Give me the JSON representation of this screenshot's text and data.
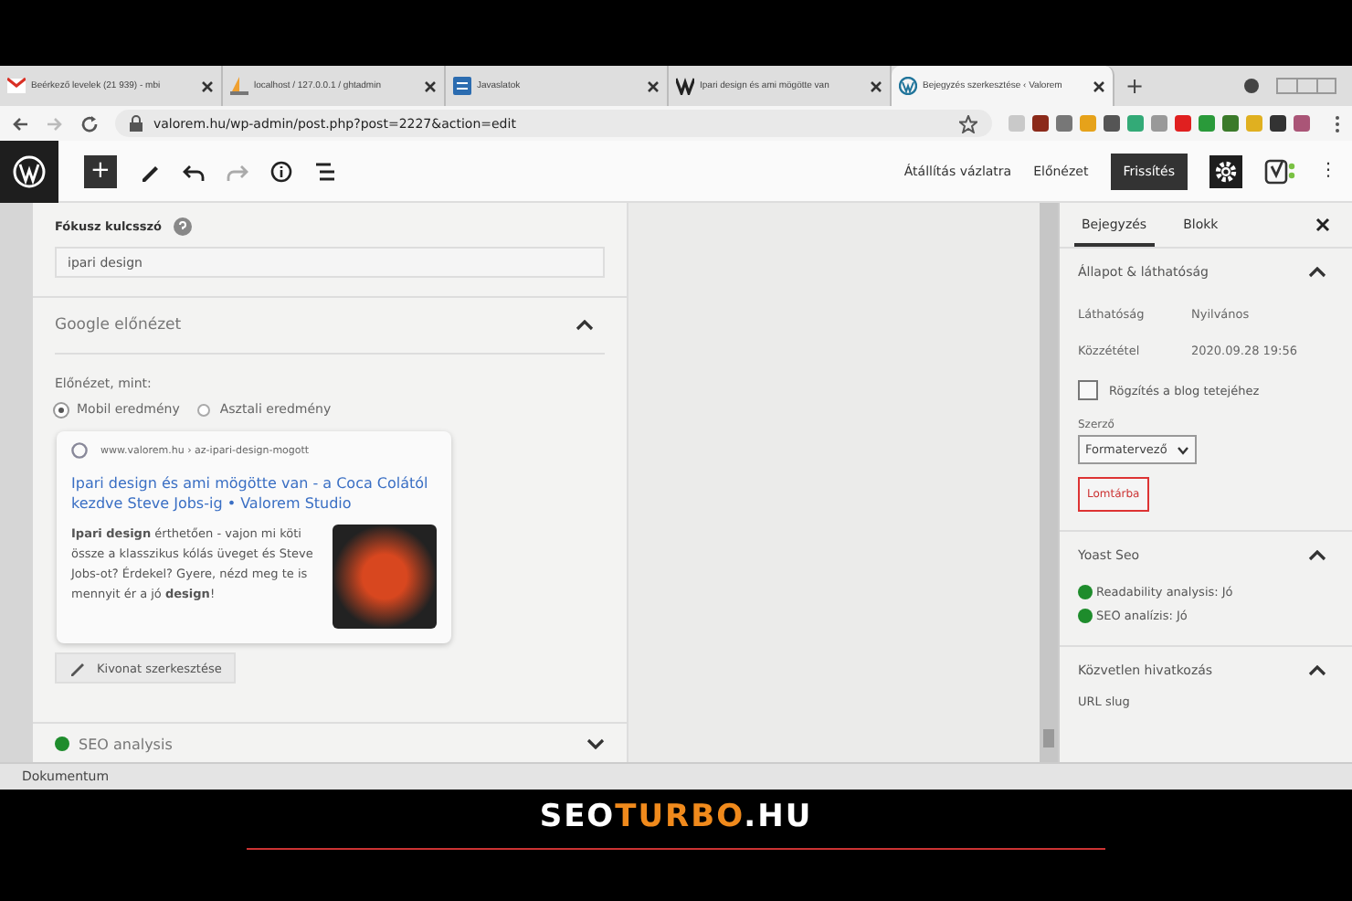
{
  "browser": {
    "tabs": [
      {
        "title": "Beérkező levelek (21 939) - mbi",
        "selected": false
      },
      {
        "title": "localhost / 127.0.0.1 / ghtadmin",
        "selected": false
      },
      {
        "title": "Javaslatok",
        "selected": false
      },
      {
        "title": "Ipari design és ami mögötte van",
        "selected": false
      },
      {
        "title": "Bejegyzés szerkesztése ‹ Valorem",
        "selected": true
      }
    ],
    "new_tab": "+",
    "url": "valorem.hu/wp-admin/post.php?post=2227&action=edit"
  },
  "toolbar": {
    "add": "+",
    "draft": "Átállítás vázlatra",
    "preview": "Előnézet",
    "update": "Frissítés",
    "more": "⋮"
  },
  "focus_keyword": {
    "label": "Fókusz kulcsszó",
    "value": "ipari design"
  },
  "google_preview": {
    "title": "Google előnézet",
    "expanded": true,
    "mode_label": "Előnézet, mint:",
    "modes": [
      {
        "label": "Mobil eredmény",
        "selected": true
      },
      {
        "label": "Asztali eredmény",
        "selected": false
      }
    ],
    "result": {
      "url": "www.valorem.hu › az-ipari-design-mogott",
      "title": "Ipari design és ami mögötte van - a Coca Colától kezdve Steve Jobs-ig • Valorem Studio",
      "description": "**Ipari design** érthetően - vajon mi köti össze a klasszikus kólás üveget és Steve Jobs-ot? Érdekel? Gyere, nézd meg te is mennyit ér a jó **design**!"
    },
    "edit_button": "Kivonat szerkesztése"
  },
  "seo_analysis": {
    "title": "SEO analysis",
    "color": "#1e8c2c",
    "expanded": false
  },
  "sidebar": {
    "tabs": [
      {
        "label": "Bejegyzés",
        "selected": true
      },
      {
        "label": "Blokk",
        "selected": false
      }
    ],
    "status": {
      "title": "Állapot & láthatóság",
      "expanded": true,
      "rows": [
        {
          "label": "Láthatóság",
          "value": "Nyilvános"
        },
        {
          "label": "Közzététel",
          "value": "2020.09.28 19:56"
        }
      ],
      "sticky": {
        "label": "Rögzítés a blog tetejéhez",
        "checked": false
      },
      "author_label": "Szerző",
      "author": "Formatervező",
      "trash": "Lomtárba"
    },
    "yoast": {
      "title": "Yoast Seo",
      "expanded": true,
      "items": [
        {
          "text": "Readability analysis: Jó",
          "color": "#1e8c2c"
        },
        {
          "text": "SEO analízis: Jó",
          "color": "#1e8c2c"
        }
      ]
    },
    "permalink": {
      "title": "Közvetlen hivatkozás",
      "expanded": true,
      "slug_label": "URL slug"
    }
  },
  "status_bar": "Dokumentum",
  "video_caption": [
    {
      "text": "SEO",
      "color": "#ffffff"
    },
    {
      "text": "TURBO",
      "color": "#f08a1c"
    },
    {
      "text": ".HU",
      "color": "#ffffff"
    }
  ]
}
